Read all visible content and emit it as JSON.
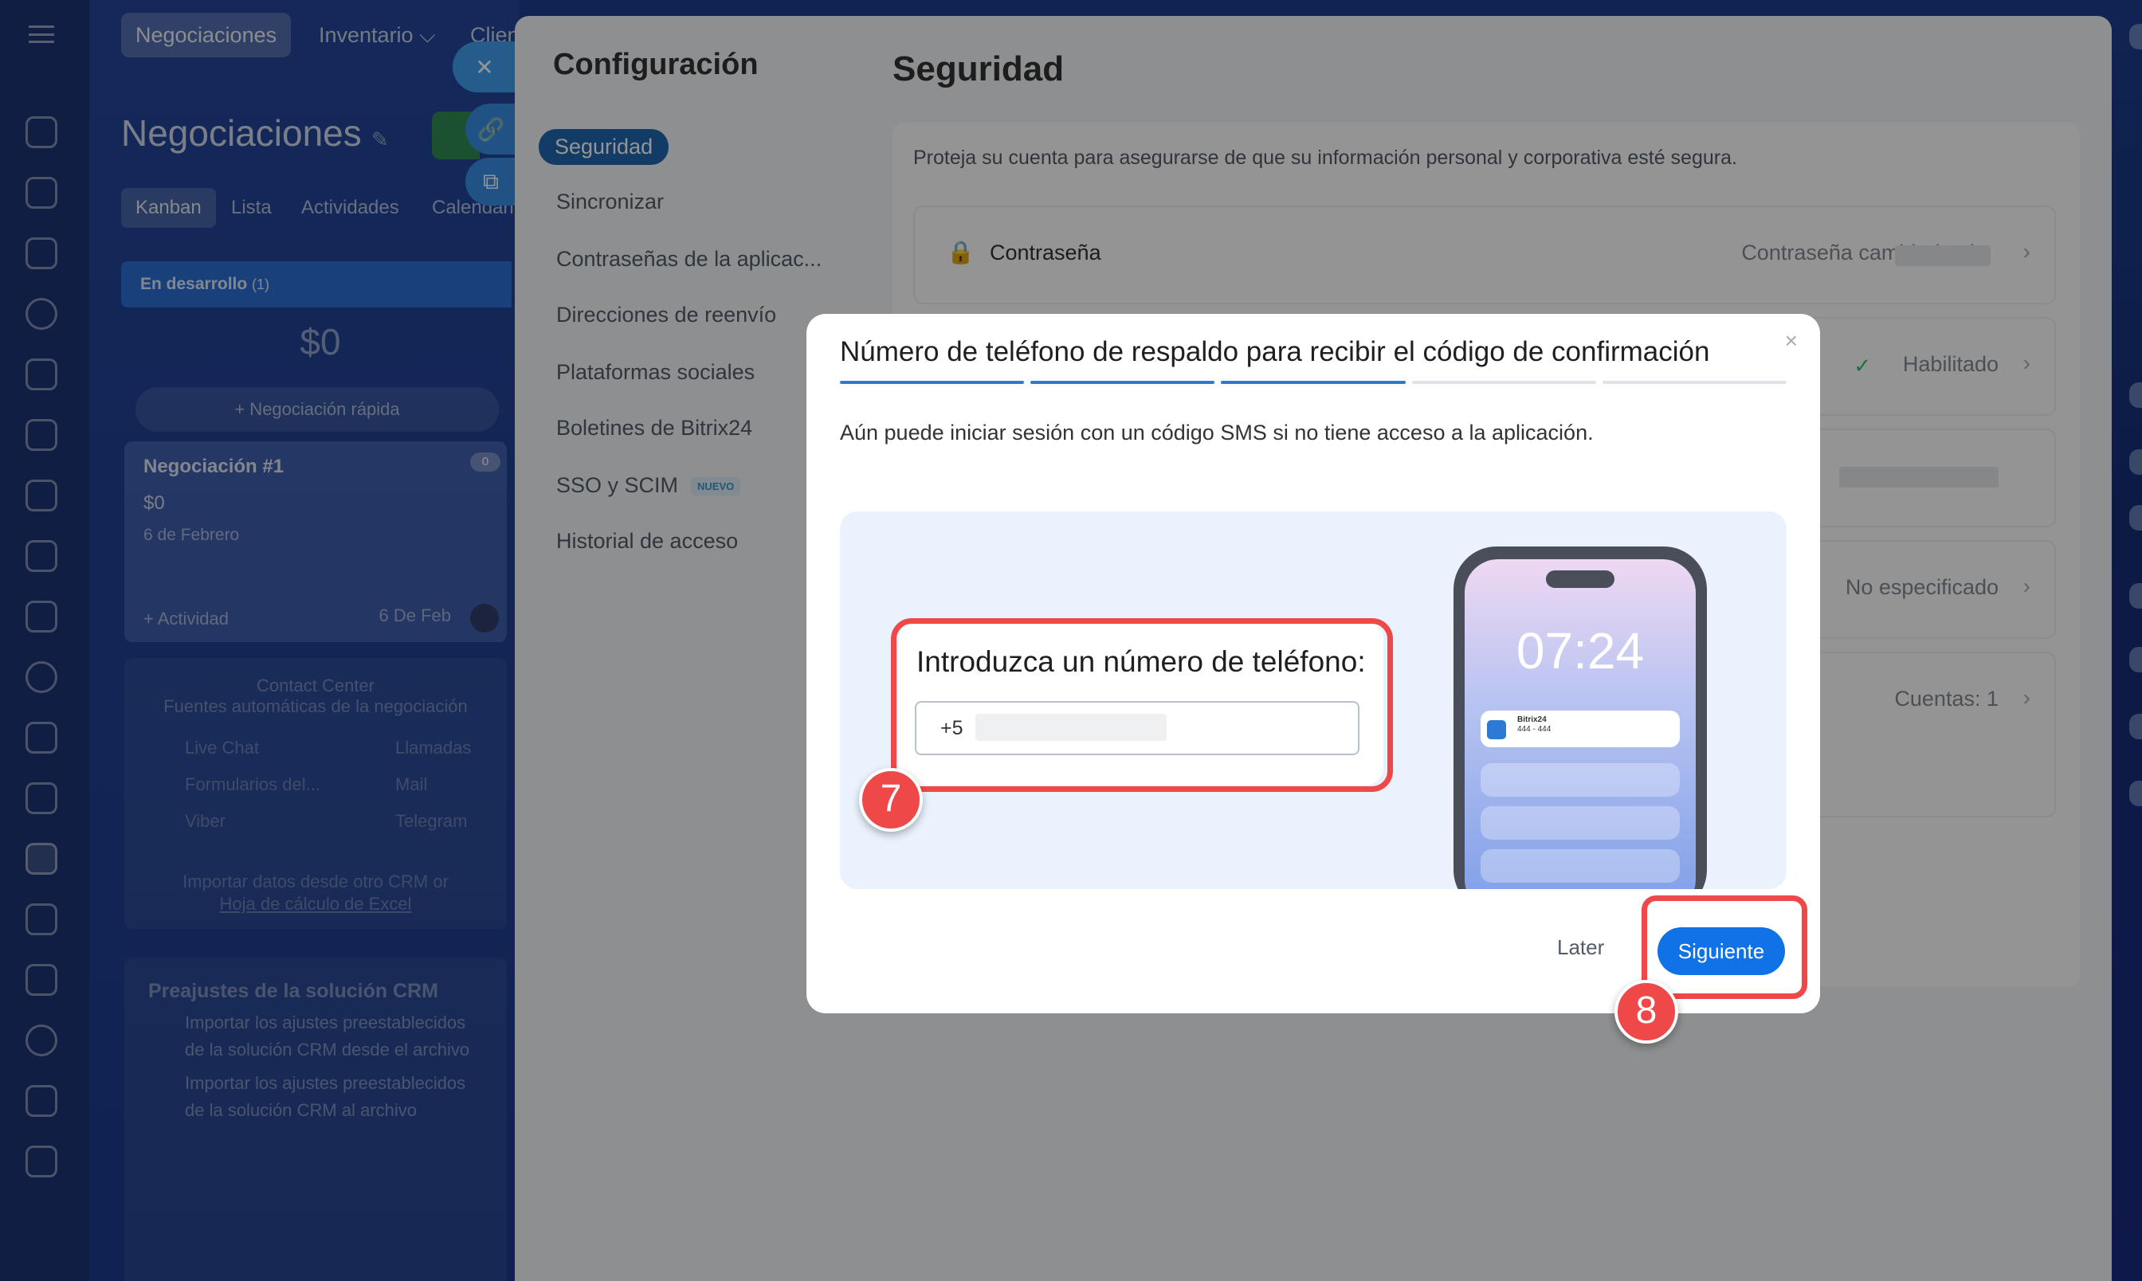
{
  "crm": {
    "top_tabs": [
      "Negociaciones",
      "Inventario ⌵",
      "Clien"
    ],
    "title": "Negociaciones",
    "view_tabs": [
      "Kanban",
      "Lista",
      "Actividades",
      "Calendari"
    ],
    "stage": {
      "name": "En desarrollo",
      "count": "(1)",
      "amount": "$0"
    },
    "quick_deal": "+ Negociación rápida",
    "deal_card": {
      "title": "Negociación #1",
      "amount": "$0",
      "date": "6 de Febrero",
      "activity": "+ Actividad",
      "short_date": "6 De Feb",
      "badge": "0"
    },
    "contact_center": {
      "title": "Contact Center",
      "subtitle": "Fuentes automáticas de la negociación",
      "items": [
        "Live Chat",
        "Llamadas",
        "Formularios del...",
        "Mail",
        "Viber",
        "Telegram"
      ],
      "import_text": "Importar datos desde otro CRM or",
      "import_link": "Hoja de cálculo de Excel"
    },
    "presets": {
      "title": "Preajustes de la solución CRM",
      "items": [
        "Importar los ajustes preestablecidos de la solución CRM desde el archivo",
        "Importar los ajustes preestablecidos de la solución CRM al archivo"
      ]
    }
  },
  "settings": {
    "title": "Configuración",
    "nav": [
      "Seguridad",
      "Sincronizar",
      "Contraseñas de la aplicac...",
      "Direcciones de reenvío",
      "Plataformas sociales",
      "Boletines de Bitrix24",
      "SSO y SCIM",
      "Historial de acceso"
    ],
    "nuevo_badge": "NUEVO",
    "section_title": "Seguridad",
    "section_desc": "Proteja su cuenta para asegurarse de que su información personal y corporativa esté segura.",
    "rows": [
      {
        "label": "Contraseña",
        "value": "Contraseña cambiada el"
      },
      {
        "label": "",
        "value": "Habilitado"
      },
      {
        "label": "",
        "value": ""
      },
      {
        "label": "",
        "value": "No especificado"
      },
      {
        "label": "",
        "value": "Cuentas: 1"
      }
    ]
  },
  "modal": {
    "title": "Número de teléfono de respaldo para recibir el código de confirmación",
    "description": "Aún puede iniciar sesión con un código SMS si no tiene acceso a la aplicación.",
    "form_label": "Introduzca un número de teléfono:",
    "phone_prefix": "+5",
    "phone_time": "07:24",
    "notification_app": "Bitrix24",
    "notification_text": "444 - 444",
    "later_label": "Later",
    "next_label": "Siguiente",
    "step_badge_1": "7",
    "step_badge_2": "8",
    "close": "×"
  },
  "colors": {
    "accent": "#0f72e6",
    "highlight": "#ef4848",
    "stage": "#2d6fd6",
    "progress_done": "#2c7ad3"
  }
}
